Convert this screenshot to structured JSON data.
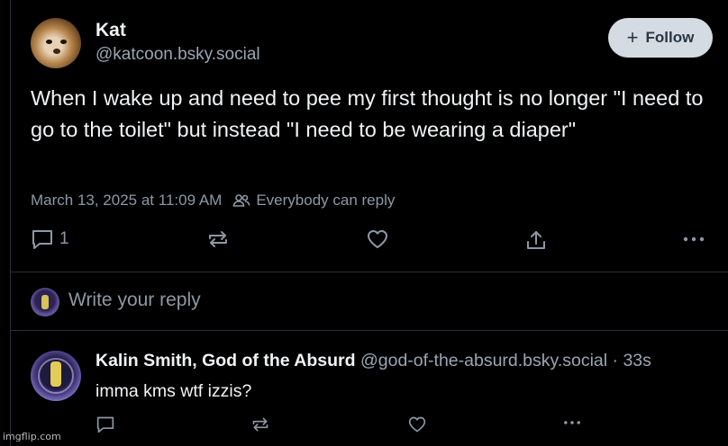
{
  "post": {
    "author_name": "Kat",
    "author_handle": "@katcoon.bsky.social",
    "follow_label": "Follow",
    "text": "When I wake up and need to pee my first thought is no longer \"I need to go to the toilet\" but instead \"I need to be wearing a diaper\"",
    "timestamp": "March 13, 2025 at 11:09 AM",
    "reply_setting": "Everybody can reply",
    "reply_count": "1"
  },
  "reply_prompt": {
    "placeholder": "Write your reply"
  },
  "reply": {
    "author_name": "Kalin Smith, God of the Absurd",
    "author_handle": "@god-of-the-absurd.bsky.social",
    "separator": "·",
    "time_ago": "33s",
    "text": "imma kms wtf izzis?"
  },
  "watermark": "imgflip.com",
  "colors": {
    "background": "#000000",
    "text": "#f1f3f5",
    "muted": "#8d98a5",
    "follow_bg": "#d4dbe2",
    "divider": "#2a2f36"
  },
  "icons": {
    "comment": "comment-icon",
    "repost": "repost-icon",
    "like": "heart-icon",
    "share": "share-icon",
    "more": "more-icon",
    "people": "people-icon",
    "plus": "plus-icon"
  }
}
